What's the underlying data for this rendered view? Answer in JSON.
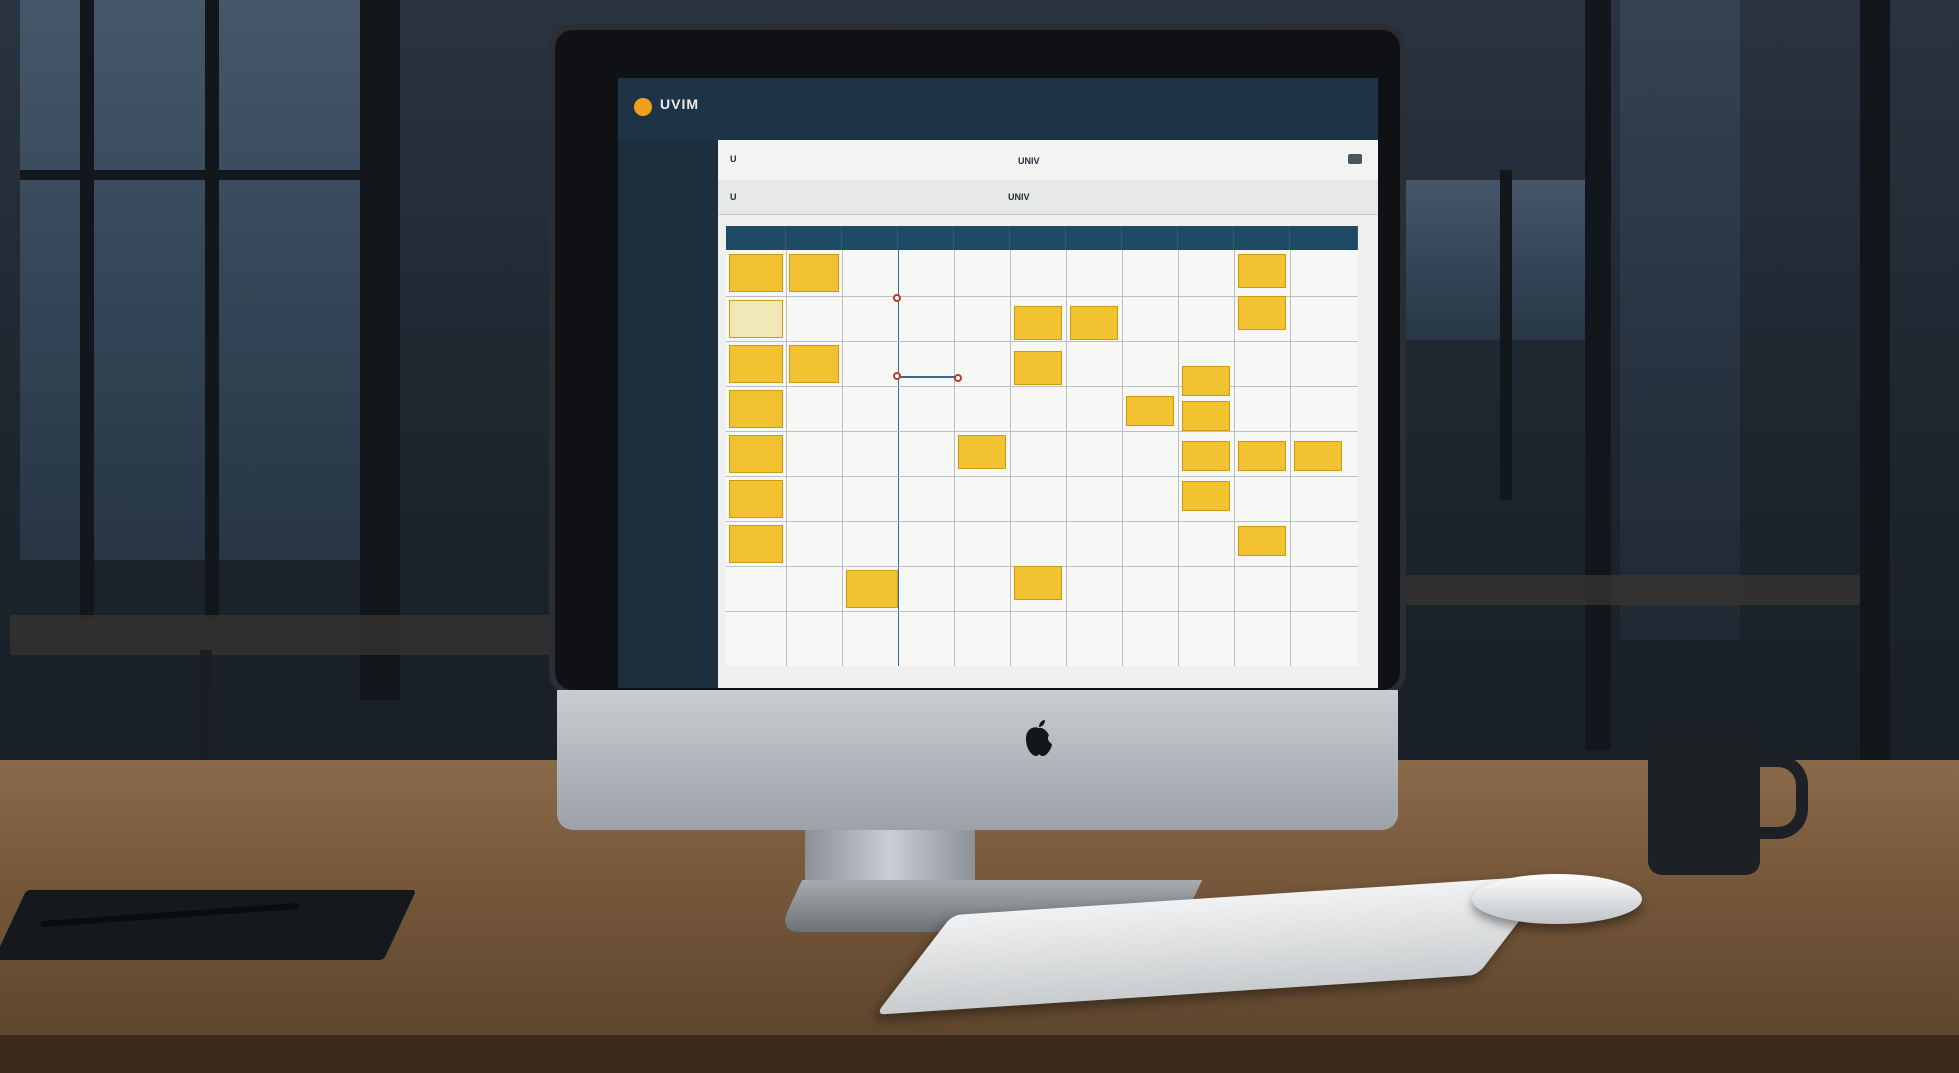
{
  "app": {
    "title": "UVIM"
  },
  "header": {
    "left_label": "U",
    "center_label": "UNIV",
    "sub_left_label": "U",
    "sub_center_label": "UNIV"
  },
  "sidebar": {
    "items": [
      "",
      "",
      "",
      "",
      "",
      "",
      "",
      "",
      "",
      "",
      ""
    ]
  },
  "calendar": {
    "day_headers": [
      "",
      "",
      "",
      "",
      "",
      "",
      "",
      "",
      "",
      "",
      ""
    ],
    "card_color": "#f2c230"
  },
  "colors": {
    "header_bg": "#1f3347",
    "sidebar_bg": "#1d2e3f",
    "day_header_bg": "#1f4a63",
    "card": "#f2c230"
  }
}
